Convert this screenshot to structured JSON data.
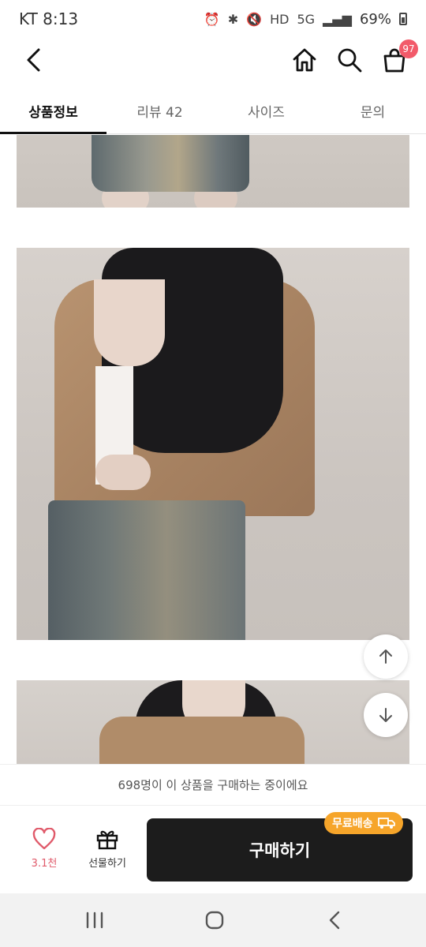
{
  "status_bar": {
    "carrier_time": "KT 8:13",
    "net1": "HD",
    "net2": "5G",
    "battery": "69%"
  },
  "header": {
    "cart_count": "97"
  },
  "tabs": [
    {
      "label": "상품정보",
      "active": true
    },
    {
      "label": "리뷰 42",
      "active": false
    },
    {
      "label": "사이즈",
      "active": false
    },
    {
      "label": "문의",
      "active": false
    }
  ],
  "notice": {
    "text": "698명이 이 상품을 구매하는 중이에요"
  },
  "bottom_bar": {
    "like_count": "3.1천",
    "gift_label": "선물하기",
    "buy_label": "구매하기",
    "free_shipping_badge": "무료배송"
  },
  "colors": {
    "accent_pink": "#e05a6a",
    "badge_orange": "#f6a52a",
    "buy_button": "#1c1c1c"
  }
}
